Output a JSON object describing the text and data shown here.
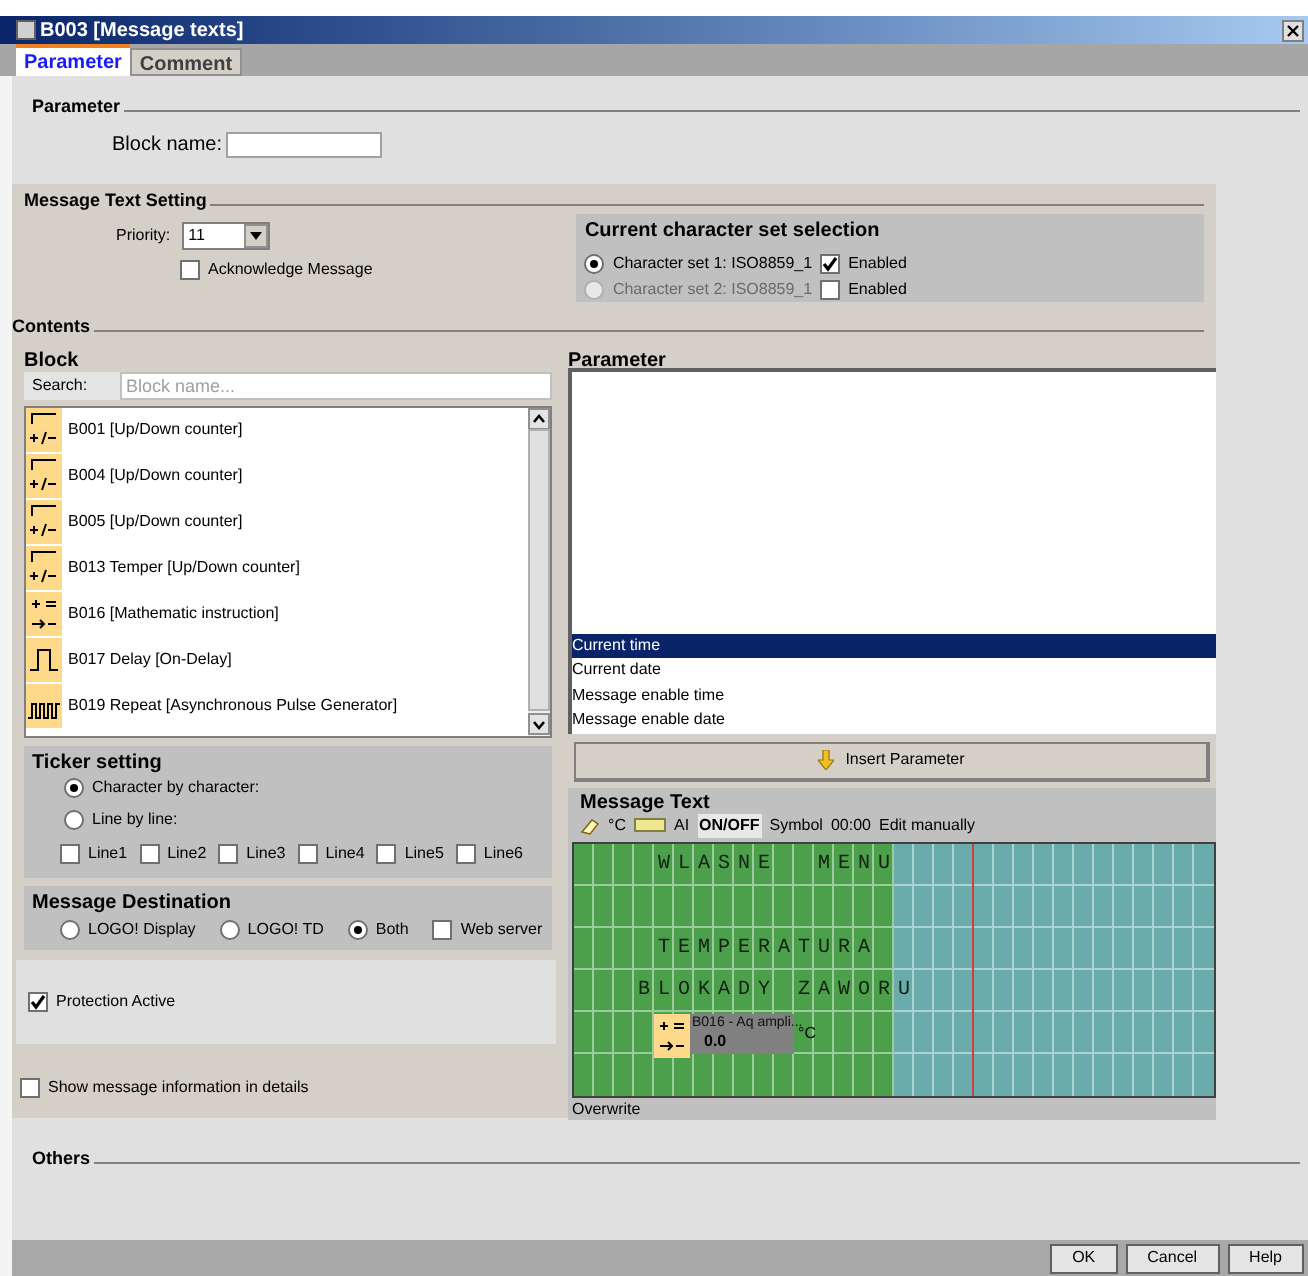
{
  "window": {
    "title": "B003 [Message texts]"
  },
  "tabs": [
    {
      "label": "Parameter",
      "selected": true
    },
    {
      "label": "Comment",
      "selected": false
    }
  ],
  "parameter": {
    "heading": "Parameter",
    "block_name_label": "Block name:"
  },
  "message_text_setting": {
    "heading": "Message Text Setting",
    "priority_label": "Priority:",
    "priority": "11",
    "acknowledge": {
      "label": "Acknowledge Message",
      "checked": false
    },
    "charset": {
      "heading": "Current character set selection",
      "options": [
        {
          "label": "Character set 1: ISO8859_1",
          "selected": true,
          "disabled": false,
          "enabled_label": "Enabled",
          "enabled": true
        },
        {
          "label": "Character set 2: ISO8859_1",
          "selected": false,
          "disabled": true,
          "enabled_label": "Enabled",
          "enabled": false
        }
      ]
    }
  },
  "contents": {
    "heading": "Contents",
    "block": {
      "heading": "Block",
      "search_label": "Search:",
      "search_placeholder": "Block name...",
      "items": [
        {
          "kind": "counter",
          "label": "B001 [Up/Down counter]"
        },
        {
          "kind": "counter",
          "label": "B004 [Up/Down counter]"
        },
        {
          "kind": "counter",
          "label": "B005 [Up/Down counter]"
        },
        {
          "kind": "counter",
          "label": "B013 Temper [Up/Down counter]"
        },
        {
          "kind": "math",
          "label": "B016 [Mathematic instruction]"
        },
        {
          "kind": "delay",
          "label": "B017 Delay [On-Delay]"
        },
        {
          "kind": "pulse",
          "label": "B019 Repeat [Asynchronous Pulse Generator]"
        }
      ]
    },
    "ticker": {
      "heading": "Ticker setting",
      "modes": [
        {
          "label": "Character by character:",
          "selected": true
        },
        {
          "label": "Line by line:",
          "selected": false
        }
      ],
      "lines": [
        {
          "label": "Line1",
          "checked": false
        },
        {
          "label": "Line2",
          "checked": false
        },
        {
          "label": "Line3",
          "checked": false
        },
        {
          "label": "Line4",
          "checked": false
        },
        {
          "label": "Line5",
          "checked": false
        },
        {
          "label": "Line6",
          "checked": false
        }
      ]
    },
    "destination": {
      "heading": "Message Destination",
      "targets": [
        {
          "label": "LOGO! Display",
          "selected": false
        },
        {
          "label": "LOGO! TD",
          "selected": false
        },
        {
          "label": "Both",
          "selected": true
        }
      ],
      "web_server": {
        "label": "Web server",
        "checked": false
      }
    },
    "protection": {
      "label": "Protection Active",
      "checked": true
    },
    "show_details": {
      "label": "Show message information in details",
      "checked": false
    },
    "parameter_panel": {
      "heading": "Parameter",
      "items": [
        {
          "label": "Current time",
          "selected": true
        },
        {
          "label": "Current date",
          "selected": false
        },
        {
          "label": "Message enable time",
          "selected": false
        },
        {
          "label": "Message enable date",
          "selected": false
        }
      ],
      "insert_button": "Insert Parameter"
    },
    "message_text": {
      "heading": "Message Text",
      "toolbar": [
        {
          "kind": "eraser"
        },
        {
          "kind": "text",
          "label": "°C"
        },
        {
          "kind": "bar"
        },
        {
          "kind": "text",
          "label": "AI"
        },
        {
          "kind": "boxed",
          "label": "ON/OFF"
        },
        {
          "kind": "text",
          "label": "Symbol"
        },
        {
          "kind": "text",
          "label": "00:00"
        },
        {
          "kind": "text",
          "label": "Edit manually"
        }
      ],
      "display_rows": [
        "    WLASNE  MENU",
        "",
        "    TEMPERATURA",
        "   BLOKADY ZAWORU",
        "",
        ""
      ],
      "block_widget": {
        "block": "B016 - Aq ampli...",
        "value": "0.0",
        "unit": "°C"
      },
      "mode": "Overwrite"
    }
  },
  "others": {
    "heading": "Others"
  },
  "buttons": [
    "OK",
    "Cancel",
    "Help"
  ]
}
